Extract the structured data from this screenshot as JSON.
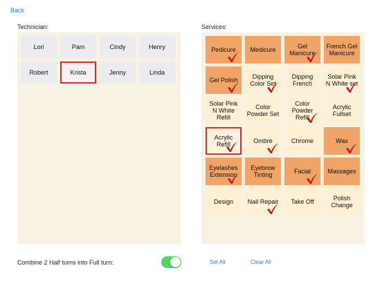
{
  "nav": {
    "back_label": "Back"
  },
  "technicians": {
    "label": "Technician:",
    "items": [
      {
        "name": "Lori",
        "selected": false
      },
      {
        "name": "Pam",
        "selected": false
      },
      {
        "name": "Cindy",
        "selected": false
      },
      {
        "name": "Henry",
        "selected": false
      },
      {
        "name": "Robert",
        "selected": false
      },
      {
        "name": "Krista",
        "selected": true
      },
      {
        "name": "Jenny",
        "selected": false
      },
      {
        "name": "Linda",
        "selected": false
      }
    ]
  },
  "services": {
    "label": "Services:",
    "items": [
      {
        "name": "Pedicure",
        "tone": "dark",
        "checked": true,
        "selected": false
      },
      {
        "name": "Medicure",
        "tone": "dark",
        "checked": false,
        "selected": false
      },
      {
        "name": "Gel Manicure",
        "tone": "dark",
        "checked": true,
        "selected": false
      },
      {
        "name": "French Gel Manicure",
        "tone": "dark",
        "checked": false,
        "selected": false
      },
      {
        "name": "Gel Polish",
        "tone": "dark",
        "checked": true,
        "selected": false
      },
      {
        "name": "Dipping Color Set",
        "tone": "light",
        "checked": true,
        "selected": false
      },
      {
        "name": "Dipping French",
        "tone": "light",
        "checked": false,
        "selected": false
      },
      {
        "name": "Solar Pink N White set",
        "tone": "light",
        "checked": true,
        "selected": false
      },
      {
        "name": "Solar Pink N White Refill",
        "tone": "light",
        "checked": false,
        "selected": false
      },
      {
        "name": "Color Powder Set",
        "tone": "light",
        "checked": false,
        "selected": false
      },
      {
        "name": "Color Powder Refill",
        "tone": "light",
        "checked": true,
        "selected": false
      },
      {
        "name": "Acrylic Fullset",
        "tone": "light",
        "checked": false,
        "selected": false
      },
      {
        "name": "Acrylic Refill",
        "tone": "light",
        "checked": true,
        "selected": true
      },
      {
        "name": "Ombre",
        "tone": "light",
        "checked": true,
        "selected": false
      },
      {
        "name": "Chrome",
        "tone": "light",
        "checked": false,
        "selected": false
      },
      {
        "name": "Wax",
        "tone": "dark",
        "checked": true,
        "selected": false
      },
      {
        "name": "Eyelashes Extension",
        "tone": "dark",
        "checked": true,
        "selected": false
      },
      {
        "name": "Eyebrow Tinting",
        "tone": "dark",
        "checked": false,
        "selected": false
      },
      {
        "name": "Facial",
        "tone": "dark",
        "checked": true,
        "selected": false
      },
      {
        "name": "Massages",
        "tone": "dark",
        "checked": false,
        "selected": false
      },
      {
        "name": "Design",
        "tone": "light",
        "checked": false,
        "selected": false
      },
      {
        "name": "Nail Repair",
        "tone": "light",
        "checked": true,
        "selected": false
      },
      {
        "name": "Take Off",
        "tone": "light",
        "checked": false,
        "selected": false
      },
      {
        "name": "Polish Change",
        "tone": "light",
        "checked": false,
        "selected": false
      }
    ]
  },
  "footer": {
    "combine_label": "Combine 2 Half turns into Full turn:",
    "combine_on": true,
    "set_all_label": "Set All",
    "clear_all_label": "Clear All"
  },
  "colors": {
    "accent_blue": "#2f7ad9",
    "selected_border": "#e0262a",
    "check_red": "#c0181e",
    "toggle_on": "#4cd964",
    "service_dark": "#f1a467",
    "service_light": "#fdf0d5",
    "panel_bg": "#f7f2e1"
  }
}
